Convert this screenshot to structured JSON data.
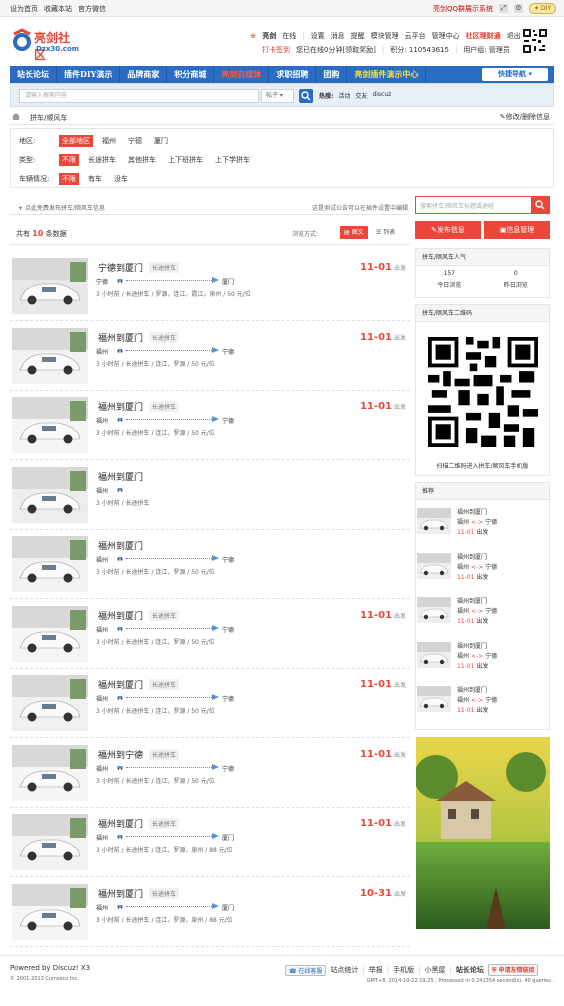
{
  "topbar": {
    "links": [
      "设为首页",
      "收藏本站",
      "官方微信"
    ],
    "promo": "亮剑QQ群展示系统",
    "diy": "DIY"
  },
  "logo": {
    "name": "亮剑社区",
    "url": "Dzx30.com"
  },
  "user": {
    "name": "亮剑",
    "status": "在线",
    "links": [
      "设置",
      "消息",
      "提醒",
      "模块管理",
      "云平台",
      "管理中心"
    ],
    "highlight": "社区理财通",
    "logout": "退出",
    "signin": "打卡签到",
    "online_note": "您已在线0分钟[领取奖励]",
    "points": "积分: 110543615",
    "group": "用户组: 管理员"
  },
  "nav": {
    "items": [
      {
        "label": "站长论坛",
        "style": "normal"
      },
      {
        "label": "插件DIY演示",
        "style": "normal"
      },
      {
        "label": "品牌商家",
        "style": "normal"
      },
      {
        "label": "积分商城",
        "style": "normal"
      },
      {
        "label": "亮剑自媒体",
        "style": "red"
      },
      {
        "label": "求职招聘",
        "style": "normal"
      },
      {
        "label": "团购",
        "style": "normal"
      },
      {
        "label": "亮剑插件演示中心",
        "style": "yellow"
      }
    ],
    "quick": "快捷导航"
  },
  "search": {
    "placeholder": "请输入搜索内容",
    "scope": "帖子",
    "hot_label": "热搜:",
    "hot": [
      "活动",
      "交友",
      "discuz"
    ]
  },
  "breadcrumb": {
    "current": "拼车/顺风车",
    "right": "修改/删除信息"
  },
  "filters": [
    {
      "label": "地区:",
      "options": [
        "全部地区",
        "福州",
        "宁德",
        "厦门"
      ],
      "active": 0
    },
    {
      "label": "类型:",
      "options": [
        "不限",
        "长途拼车",
        "其他拼车",
        "上下班拼车",
        "上下学拼车"
      ],
      "active": 0
    },
    {
      "label": "车辆情况:",
      "options": [
        "不限",
        "有车",
        "没车"
      ],
      "active": 0
    }
  ],
  "addbar": {
    "left": "点此免费发布拼车/顺风车信息",
    "right": "这是测试公告可以在插件设置中编辑"
  },
  "count": {
    "prefix": "共有",
    "num": "10",
    "suffix": "条数据"
  },
  "viewmode": {
    "label": "浏览方式:",
    "graphic": "图文",
    "list": "列表"
  },
  "listings": [
    {
      "title": "宁德到厦门",
      "tag": "长途拼车",
      "from": "宁德",
      "to": "厦门",
      "detail": "3 小时前 / 长途拼车 / 罗源，连江，霞江，泉州 / 50 元/位",
      "date": "11-01",
      "depart": "出发",
      "car": "#e8e8e8"
    },
    {
      "title": "福州到厦门",
      "tag": "长途拼车",
      "from": "福州",
      "to": "宁德",
      "detail": "3 小时前 / 长途拼车 / 连江，罗源 / 50 元/位",
      "date": "11-01",
      "depart": "出发",
      "car": "#f2f2f2"
    },
    {
      "title": "福州到厦门",
      "tag": "长途拼车",
      "from": "福州",
      "to": "宁德",
      "detail": "3 小时前 / 长途拼车 / 连江，罗源 / 50 元/位",
      "date": "11-01",
      "depart": "出发",
      "car": "#f5f5f5"
    },
    {
      "title": "福州到厦门",
      "tag": "",
      "from": "福州",
      "to": "",
      "detail": "3 小时前 / 长途拼车",
      "date": "",
      "depart": "",
      "car": "#ededed"
    },
    {
      "title": "福州到厦门",
      "tag": "",
      "from": "福州",
      "to": "宁德",
      "detail": "3 小时前 / 长途拼车 / 连江，罗源 / 50 元/位",
      "date": "",
      "depart": "",
      "car": "#f2f2f2"
    },
    {
      "title": "福州到厦门",
      "tag": "长途拼车",
      "from": "福州",
      "to": "宁德",
      "detail": "3 小时前 / 长途拼车 / 连江，罗源 / 50 元/位",
      "date": "11-01",
      "depart": "出发",
      "car": "#f5f5f5"
    },
    {
      "title": "福州到厦门",
      "tag": "长途拼车",
      "from": "福州",
      "to": "宁德",
      "detail": "3 小时前 / 长途拼车 / 连江，罗源 / 50 元/位",
      "date": "11-01",
      "depart": "出发",
      "car": "#f0f0f0"
    },
    {
      "title": "福州到宁德",
      "tag": "长途拼车",
      "from": "福州",
      "to": "宁德",
      "detail": "3 小时前 / 长途拼车 / 连江，罗源 / 50 元/位",
      "date": "11-01",
      "depart": "出发",
      "car": "#f5f5f5"
    },
    {
      "title": "福州到厦门",
      "tag": "长途拼车",
      "from": "福州",
      "to": "厦门",
      "detail": "3 小时前 / 长途拼车 / 连江，罗源，泉州 / 88 元/位",
      "date": "11-01",
      "depart": "出发",
      "car": "#f2f2f2"
    },
    {
      "title": "福州到厦门",
      "tag": "长途拼车",
      "from": "福州",
      "to": "厦门",
      "detail": "3 小时前 / 长途拼车 / 连江，罗源，泉州 / 88 元/位",
      "date": "10-31",
      "depart": "出发",
      "car": "#f5f5f5"
    }
  ],
  "sidebar": {
    "search_placeholder": "搜索拼车/顺风车标题或途经",
    "post_btn": "发布信息",
    "manage_btn": "信息管理",
    "pop_title": "拼车/顺风车人气",
    "today_num": "157",
    "today_label": "今日浏览",
    "yest_num": "0",
    "yest_label": "昨日浏览",
    "qr_title": "拼车/顺风车二维码",
    "qr_caption": "扫描二维码进入拼车/顺风车手机版",
    "rec_title": "推荐",
    "recs": [
      {
        "title": "福州到厦门",
        "from": "福州",
        "to": "宁德",
        "date": "11-01",
        "depart": "出发"
      },
      {
        "title": "福州到厦门",
        "from": "福州",
        "to": "宁德",
        "date": "11-01",
        "depart": "出发"
      },
      {
        "title": "福州到厦门",
        "from": "福州",
        "to": "宁德",
        "date": "11-01",
        "depart": "出发"
      },
      {
        "title": "福州到厦门",
        "from": "福州",
        "to": "宁德",
        "date": "11-01",
        "depart": "出发"
      },
      {
        "title": "福州到厦门",
        "from": "福州",
        "to": "宁德",
        "date": "11-01",
        "depart": "出发"
      }
    ]
  },
  "footer": {
    "powered": "Powered by Discuz! X3",
    "copyright": "© 2001-2013 Comsenz Inc.",
    "service": "在线客服",
    "links": [
      "站点统计",
      "举报",
      "手机版",
      "小黑屋",
      "站长论坛"
    ],
    "friend": "申请友情链接",
    "gmt": "GMT+8, 2014-10-22 19:25 , Processed in 0.241354 second(s), 40 queries ."
  },
  "colors": {
    "accent": "#e8473a",
    "nav": "#2a6cc3"
  }
}
